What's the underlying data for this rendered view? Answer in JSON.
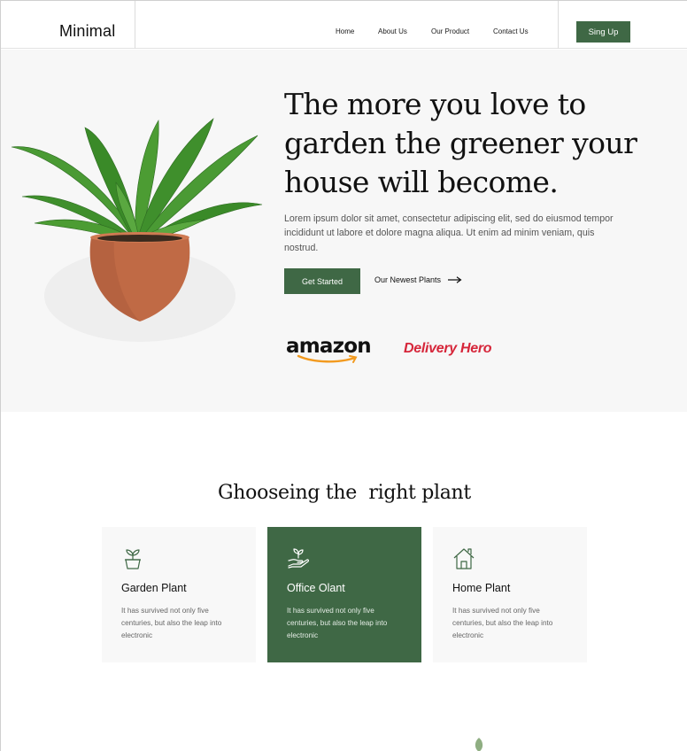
{
  "header": {
    "logo": "Minimal",
    "nav": [
      {
        "label": "Home"
      },
      {
        "label": "About Us"
      },
      {
        "label": "Our Product"
      },
      {
        "label": "Contact Us"
      }
    ],
    "signup_label": "Sing Up"
  },
  "hero": {
    "headline": [
      "The more you love to",
      "garden the greener your",
      "house will become."
    ],
    "lede": "Lorem ipsum dolor sit amet, consectetur adipiscing elit, sed do eiusmod tempor incididunt ut labore et dolore magna aliqua. Ut enim ad minim veniam, quis nostrud.",
    "cta_primary": "Get Started",
    "cta_secondary": "Our Newest Plants",
    "partners": [
      "amazon",
      "Delivery Hero"
    ]
  },
  "section": {
    "title": "Ghooseing the  right plant",
    "cards": [
      {
        "title": "Garden Plant",
        "desc": "It has survived not only five centuries, but also the leap into electronic",
        "icon": "potted-plant-icon"
      },
      {
        "title": "Office Olant",
        "desc": "It has survived not only five centuries, but also the leap into electronic",
        "icon": "hand-plant-icon"
      },
      {
        "title": "Home Plant",
        "desc": "It has survived not only five centuries, but also the leap into electronic",
        "icon": "house-icon"
      }
    ]
  },
  "colors": {
    "accent": "#3f6845",
    "hero_bg": "#f7f7f7",
    "brand_red": "#d6263a",
    "amazon_orange": "#f29a1f"
  }
}
